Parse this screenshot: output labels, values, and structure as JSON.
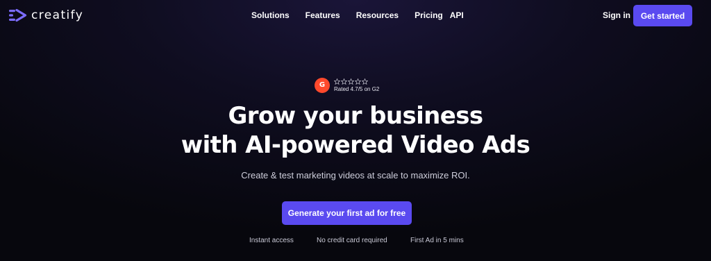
{
  "brand": {
    "name": "creatify",
    "logo_icon": "creatify-logo-icon"
  },
  "nav": {
    "items": [
      {
        "label": "Solutions"
      },
      {
        "label": "Features"
      },
      {
        "label": "Resources"
      },
      {
        "label": "Pricing"
      },
      {
        "label": "API"
      }
    ],
    "sign_in": "Sign in",
    "get_started": "Get started"
  },
  "rating": {
    "badge_text": "G",
    "badge_icon": "g2-logo-icon",
    "stars": 5,
    "text": "Rated 4.7/5 on G2"
  },
  "hero": {
    "title_line1": "Grow your business",
    "title_line2": "with AI-powered Video Ads",
    "subtitle": "Create & test marketing videos at scale to maximize ROI.",
    "cta": "Generate your first ad for free"
  },
  "perks": [
    "Instant access",
    "No credit card required",
    "First Ad in 5 mins"
  ],
  "colors": {
    "accent": "#5a4af0",
    "background": "#0b0a16",
    "g2": "#ff492c"
  }
}
